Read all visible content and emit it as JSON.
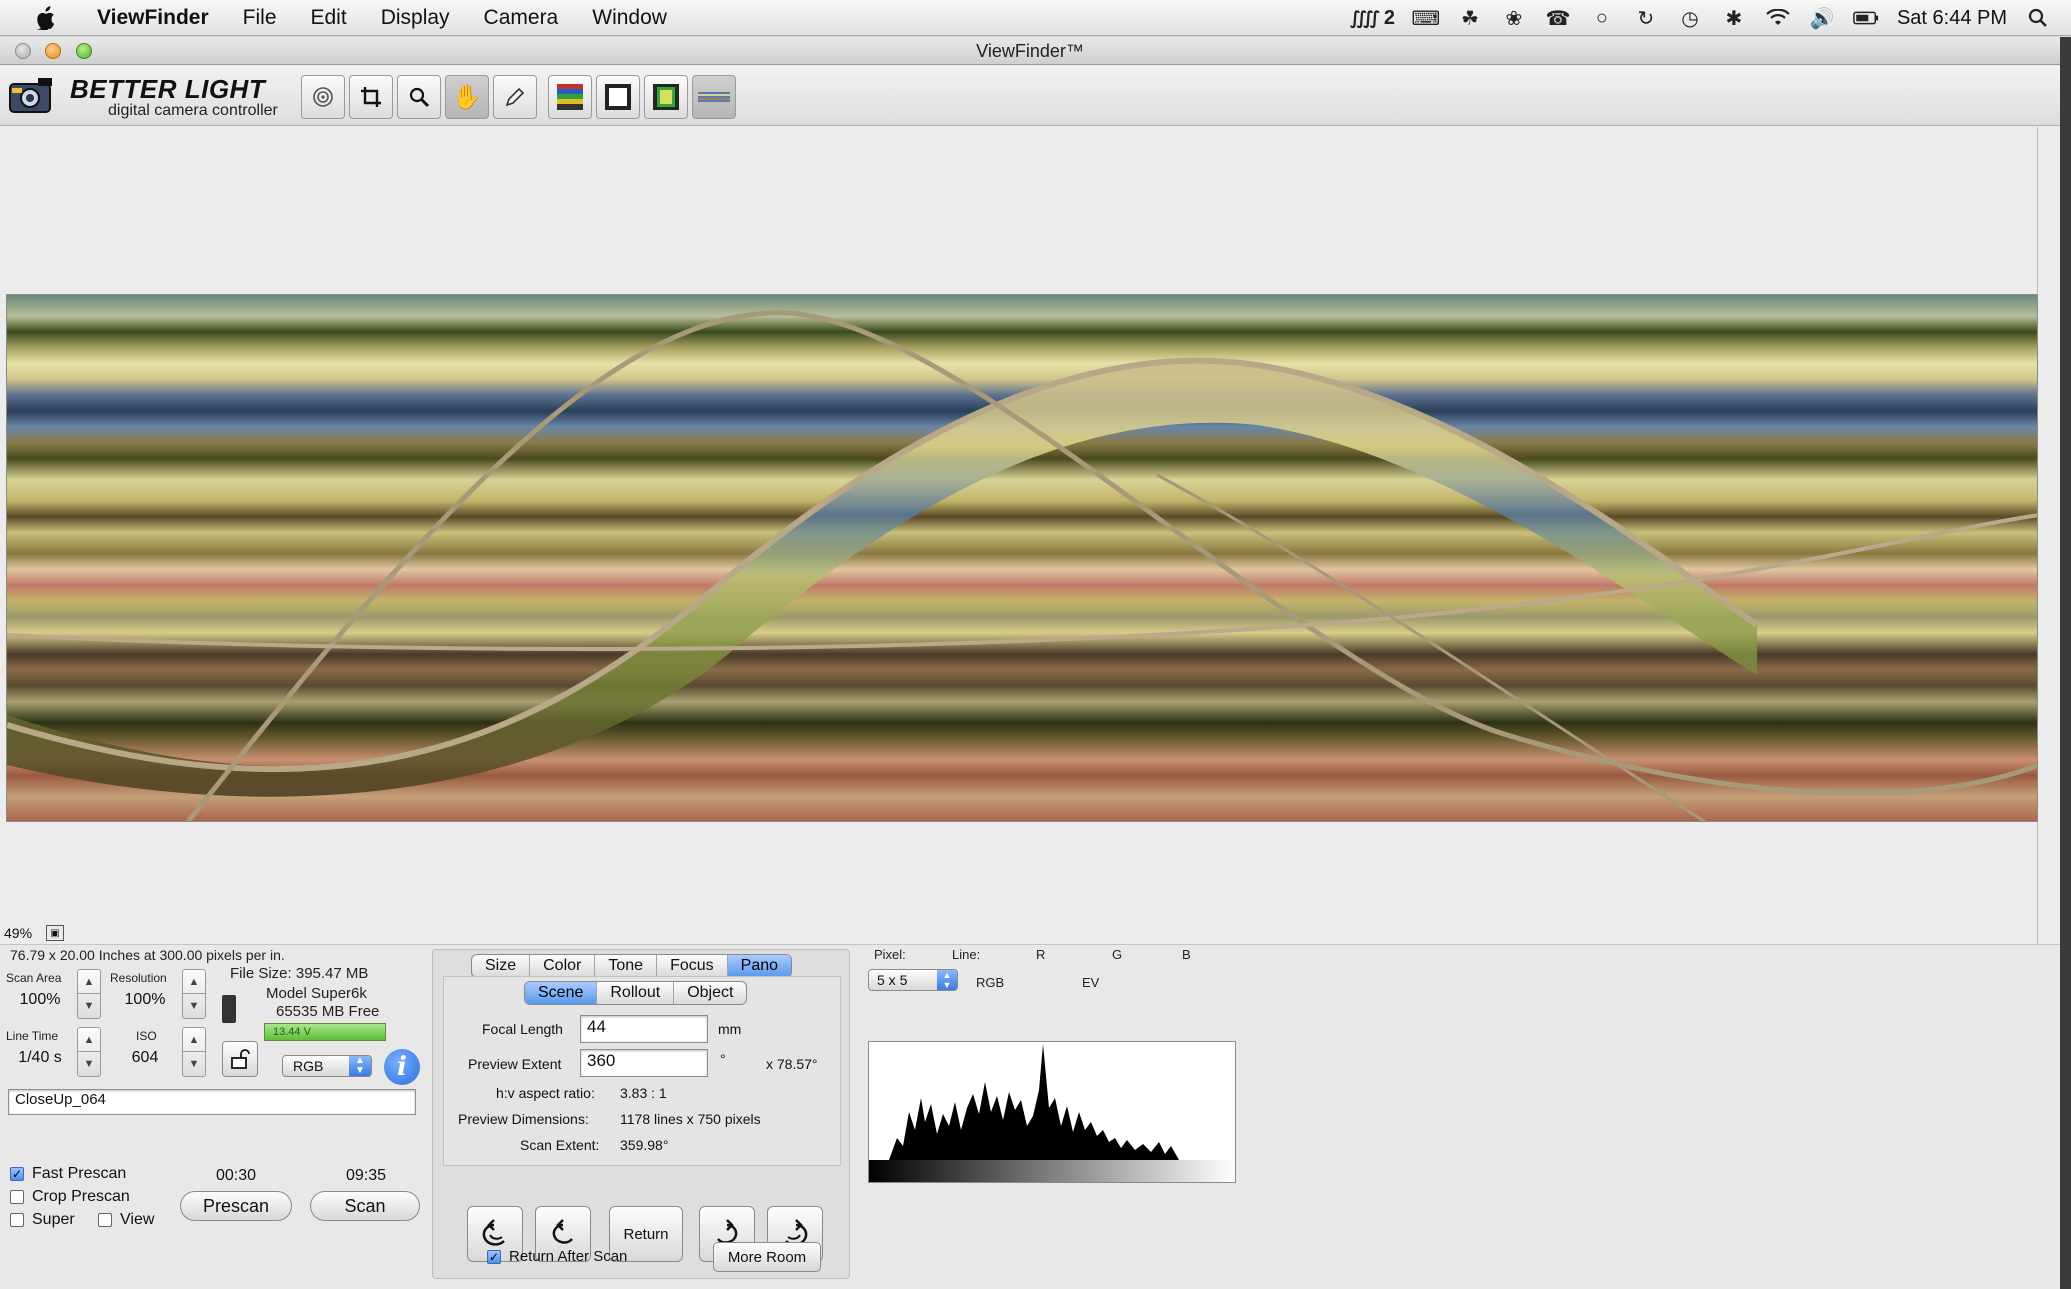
{
  "menubar": {
    "app": "ViewFinder",
    "items": [
      "File",
      "Edit",
      "Display",
      "Camera",
      "Window"
    ],
    "status_text": "2",
    "clock": "Sat 6:44 PM"
  },
  "window": {
    "title": "ViewFinder™"
  },
  "toolbar": {
    "brand": "BETTER LIGHT",
    "subtitle": "digital camera controller"
  },
  "preview": {
    "zoom": "49%"
  },
  "info": {
    "dimensions": "76.79 x 20.00 Inches at 300.00 pixels per in.",
    "scan_area_label": "Scan Area",
    "scan_area_value": "100%",
    "resolution_label": "Resolution",
    "resolution_value": "100%",
    "file_size": "File Size: 395.47 MB",
    "model": "Model Super6k",
    "free": "65535 MB Free",
    "battery": "13.44 V",
    "line_time_label": "Line Time",
    "line_time_value": "1/40 s",
    "iso_label": "ISO",
    "iso_value": "604",
    "color_mode": "RGB",
    "filename": "CloseUp_064",
    "fast_prescan_label": "Fast Prescan",
    "crop_prescan_label": "Crop Prescan",
    "super_label": "Super",
    "view_label": "View",
    "prescan_time": "00:30",
    "scan_time": "09:35",
    "prescan_button": "Prescan",
    "scan_button": "Scan"
  },
  "tabs": [
    "Size",
    "Color",
    "Tone",
    "Focus",
    "Pano"
  ],
  "subtabs": [
    "Scene",
    "Rollout",
    "Object"
  ],
  "pano": {
    "focal_length_label": "Focal Length",
    "focal_length_value": "44",
    "focal_length_unit": "mm",
    "preview_extent_label": "Preview Extent",
    "preview_extent_value": "360",
    "preview_extent_unit": "°",
    "preview_extent_extra": "x 78.57°",
    "aspect_label": "h:v aspect ratio:",
    "aspect_value": "3.83 : 1",
    "dims_label": "Preview Dimensions:",
    "dims_value": "1178 lines x 750 pixels",
    "scan_extent_label": "Scan Extent:",
    "scan_extent_value": "359.98°",
    "return_button": "Return",
    "return_after_scan_label": "Return After Scan",
    "more_room_button": "More Room"
  },
  "histogram": {
    "pixel_label": "Pixel:",
    "line_label": "Line:",
    "r_label": "R",
    "g_label": "G",
    "b_label": "B",
    "sample_size": "5 x 5",
    "rgb_label": "RGB",
    "ev_label": "EV"
  },
  "colors": {
    "selected_tab": "#5a98ec",
    "battery_bar": "#5fbf3a",
    "info_button": "#2a6fd8"
  }
}
